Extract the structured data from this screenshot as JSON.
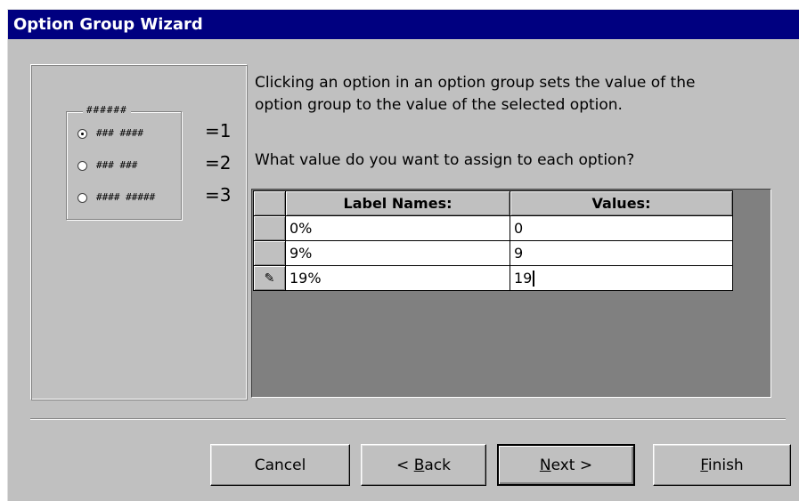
{
  "window": {
    "title": "Option Group Wizard"
  },
  "preview": {
    "frame_caption": "######",
    "options": [
      {
        "label": "### ####",
        "selected": true,
        "value_label": "=1"
      },
      {
        "label": "### ###",
        "selected": false,
        "value_label": "=2"
      },
      {
        "label": "#### #####",
        "selected": false,
        "value_label": "=3"
      }
    ]
  },
  "instructions": {
    "line1": "Clicking an option in an option group sets the value of the",
    "line2": "option group to the value of the selected option.",
    "question": "What value do you want to assign to each option?"
  },
  "grid": {
    "headers": {
      "label_names": "Label Names:",
      "values": "Values:"
    },
    "rows": [
      {
        "selector": "",
        "label": "0%",
        "value": "0"
      },
      {
        "selector": "",
        "label": "9%",
        "value": "9"
      },
      {
        "selector": "✎",
        "label": "19%",
        "value": "19"
      }
    ]
  },
  "buttons": {
    "cancel": "Cancel",
    "back_prefix": "< ",
    "back_mnemonic": "B",
    "back_rest": "ack",
    "next_mnemonic": "N",
    "next_rest": "ext >",
    "finish_mnemonic": "F",
    "finish_rest": "inish"
  }
}
